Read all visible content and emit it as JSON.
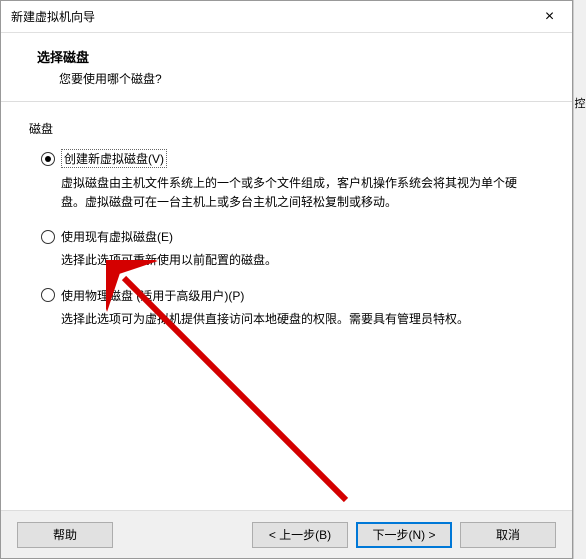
{
  "titlebar": {
    "title": "新建虚拟机向导",
    "close": "×"
  },
  "header": {
    "title": "选择磁盘",
    "subtitle": "您要使用哪个磁盘?"
  },
  "group": {
    "label": "磁盘"
  },
  "options": {
    "o1": {
      "label": "创建新虚拟磁盘(V)",
      "desc": "虚拟磁盘由主机文件系统上的一个或多个文件组成，客户机操作系统会将其视为单个硬盘。虚拟磁盘可在一台主机上或多台主机之间轻松复制或移动。"
    },
    "o2": {
      "label": "使用现有虚拟磁盘(E)",
      "desc": "选择此选项可重新使用以前配置的磁盘。"
    },
    "o3": {
      "label": "使用物理磁盘 (适用于高级用户)(P)",
      "desc": "选择此选项可为虚拟机提供直接访问本地硬盘的权限。需要具有管理员特权。"
    }
  },
  "footer": {
    "help": "帮助",
    "back": "< 上一步(B)",
    "next": "下一步(N) >",
    "cancel": "取消"
  },
  "side": "控"
}
